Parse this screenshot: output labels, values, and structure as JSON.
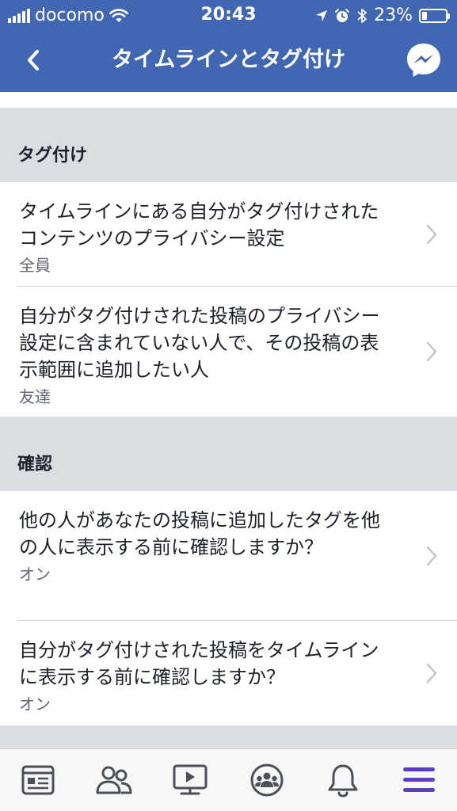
{
  "status_bar": {
    "carrier": "docomo",
    "time": "20:43",
    "battery": "23%",
    "battery_level": 0.23,
    "icons": [
      "signal-icon",
      "wifi-icon",
      "location-icon",
      "alarm-icon",
      "bluetooth-icon",
      "battery-icon"
    ]
  },
  "nav": {
    "title": "タイムラインとタグ付け",
    "back_icon": "chevron-left-icon",
    "messenger_icon": "messenger-icon"
  },
  "sections": [
    {
      "header": "タグ付け",
      "rows": [
        {
          "title": "タイムラインにある自分がタグ付けされたコンテンツのプライバシー設定",
          "value": "全員"
        },
        {
          "title": "自分がタグ付けされた投稿のプライバシー設定に含まれていない人で、その投稿の表示範囲に追加したい人",
          "value": "友達"
        }
      ]
    },
    {
      "header": "確認",
      "rows": [
        {
          "title": "他の人があなたの投稿に追加したタグを他の人に表示する前に確認しますか？",
          "value": "オン"
        },
        {
          "title": "自分がタグ付けされた投稿をタイムラインに表示する前に確認しますか？",
          "value": "オン"
        }
      ]
    }
  ],
  "tab_bar": {
    "tabs": [
      {
        "icon": "news-feed-icon",
        "active": false
      },
      {
        "icon": "friends-icon",
        "active": false
      },
      {
        "icon": "watch-icon",
        "active": false
      },
      {
        "icon": "groups-icon",
        "active": false
      },
      {
        "icon": "notifications-icon",
        "active": false
      },
      {
        "icon": "menu-icon",
        "active": true
      }
    ]
  },
  "colors": {
    "brand_blue": "#4267b2",
    "section_gray": "#dadde1",
    "secondary_text": "#606770",
    "active_tab": "#5c3fc1",
    "inactive_tab": "#4b4f56"
  }
}
